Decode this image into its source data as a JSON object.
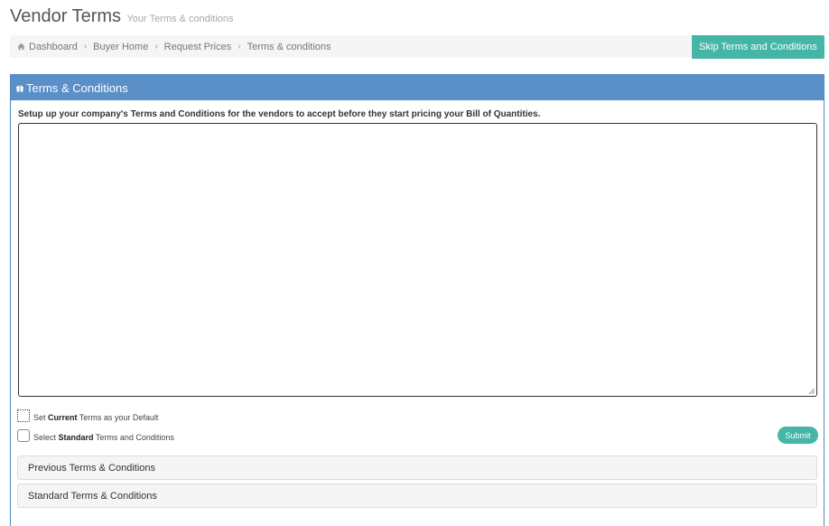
{
  "header": {
    "title": "Vendor Terms",
    "subtitle": "Your Terms & conditions"
  },
  "breadcrumb": {
    "items": [
      "Dashboard",
      "Buyer Home",
      "Request Prices",
      "Terms & conditions"
    ],
    "separator": "›"
  },
  "skip_button": {
    "label": "Skip Terms and Conditions"
  },
  "panel": {
    "title": "Terms & Conditions",
    "instructions": "Setup up your company's Terms and Conditions for the vendors to accept before they start pricing your Bill of Quantities.",
    "textarea_value": ""
  },
  "options": {
    "default_pre": "Set ",
    "default_bold": "Current",
    "default_post": " Terms as your Default",
    "standard_pre": "Select ",
    "standard_bold": "Standard",
    "standard_post": " Terms and Conditions"
  },
  "submit_button": {
    "label": "Submit"
  },
  "accordions": {
    "previous": "Previous Terms & Conditions",
    "standard": "Standard Terms & Conditions"
  },
  "colors": {
    "accent_teal": "#45b6a6",
    "panel_blue": "#5a8fc8",
    "breadcrumb_bg": "#f5f5f5"
  },
  "icons": {
    "breadcrumb_home": "home-icon",
    "panel_heading": "gift-icon"
  }
}
